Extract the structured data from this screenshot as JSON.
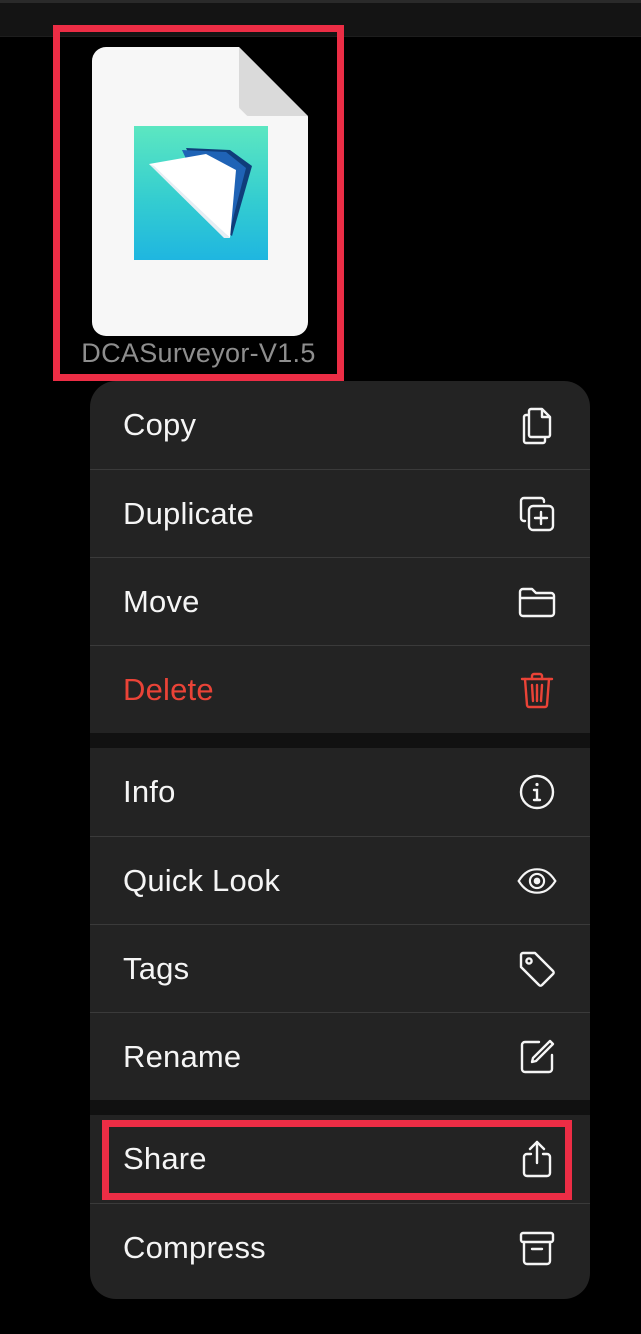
{
  "file": {
    "name": "DCASurveyor-V1.5",
    "icon": "filemaker-folder-icon"
  },
  "colors": {
    "background": "#000000",
    "menu_background": "#232323",
    "destructive": "#ea4337",
    "highlight": "#ec2d45"
  },
  "menu": {
    "groups": [
      {
        "items": [
          {
            "label": "Copy",
            "icon": "copy-icon"
          },
          {
            "label": "Duplicate",
            "icon": "duplicate-icon"
          },
          {
            "label": "Move",
            "icon": "folder-icon"
          },
          {
            "label": "Delete",
            "icon": "trash-icon",
            "destructive": true
          }
        ]
      },
      {
        "items": [
          {
            "label": "Info",
            "icon": "info-icon"
          },
          {
            "label": "Quick Look",
            "icon": "eye-icon"
          },
          {
            "label": "Tags",
            "icon": "tag-icon"
          },
          {
            "label": "Rename",
            "icon": "edit-icon"
          }
        ]
      },
      {
        "items": [
          {
            "label": "Share",
            "icon": "share-icon",
            "highlighted": true
          },
          {
            "label": "Compress",
            "icon": "archive-icon"
          }
        ]
      }
    ]
  }
}
